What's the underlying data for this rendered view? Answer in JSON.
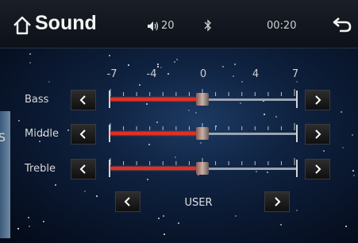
{
  "header": {
    "title": "Sound",
    "volume": "20",
    "time": "00:20"
  },
  "side_panel_text": "S",
  "scale_labels": [
    "-7",
    "-4",
    "0",
    "4",
    "7"
  ],
  "bands": [
    {
      "label": "Bass",
      "level": 0
    },
    {
      "label": "Middle",
      "level": 0
    },
    {
      "label": "Treble",
      "level": 0
    }
  ],
  "mode": {
    "label": "USER"
  },
  "colors": {
    "accent": "#e03024",
    "header_bg": "#141a23",
    "background": "#0f2240"
  },
  "icons": [
    "home-icon",
    "volume-icon",
    "bluetooth-icon",
    "back-icon",
    "chevron-left-icon",
    "chevron-right-icon"
  ]
}
